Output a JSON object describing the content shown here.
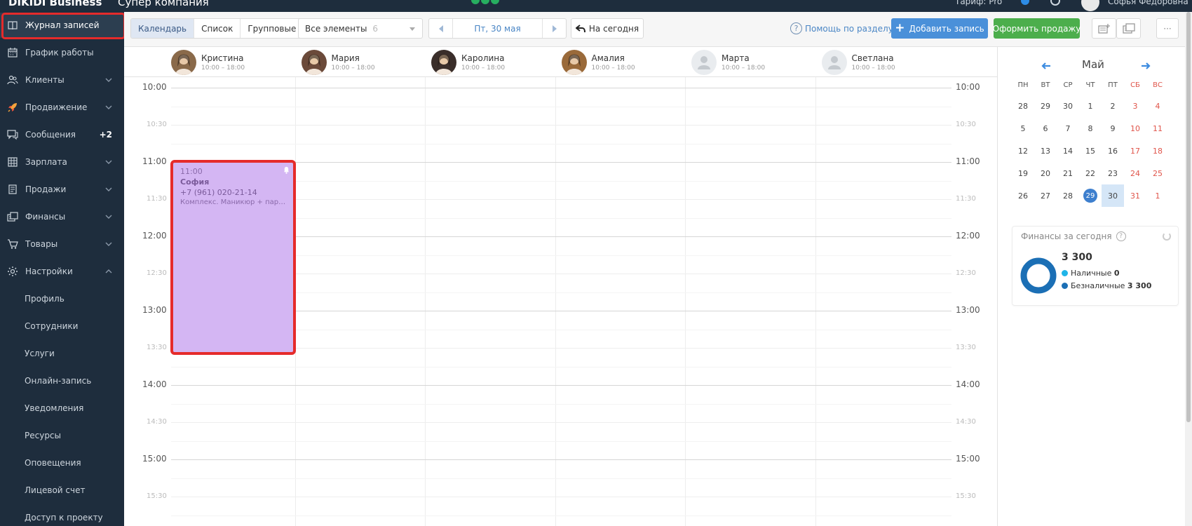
{
  "topbar": {
    "brand": "DIKIDI Business",
    "company": "Супер компания",
    "tariff": "Тариф: Pro",
    "user": "Софья Федоровна"
  },
  "sidebar": {
    "items": [
      {
        "label": "Журнал записей",
        "icon": "journal-icon",
        "active": true
      },
      {
        "label": "График работы",
        "icon": "calendar-grid-icon"
      },
      {
        "label": "Клиенты",
        "icon": "clients-icon",
        "chevron": true
      },
      {
        "label": "Продвижение",
        "icon": "rocket-icon",
        "chevron": true
      },
      {
        "label": "Сообщения",
        "icon": "messages-icon",
        "badge": "+2"
      },
      {
        "label": "Зарплата",
        "icon": "salary-icon",
        "chevron": true
      },
      {
        "label": "Продажи",
        "icon": "sales-icon",
        "chevron": true
      },
      {
        "label": "Финансы",
        "icon": "finance-icon",
        "chevron": true
      },
      {
        "label": "Товары",
        "icon": "cart-icon",
        "chevron": true
      },
      {
        "label": "Настройки",
        "icon": "gear-icon",
        "chevron": true,
        "expanded": true
      }
    ],
    "subitems": [
      "Профиль",
      "Сотрудники",
      "Услуги",
      "Онлайн-запись",
      "Уведомления",
      "Ресурсы",
      "Оповещения",
      "Лицевой счет",
      "Доступ к проекту"
    ]
  },
  "toolbar": {
    "views": [
      "Календарь",
      "Список",
      "Групповые"
    ],
    "filter_label": "Все элементы",
    "filter_count": "6",
    "date": "Пт, 30 мая",
    "today_button": "На сегодня",
    "help": "Помощь по разделу",
    "add_button": "Добавить запись",
    "sale_button": "Оформить продажу",
    "more": "···"
  },
  "staff": [
    {
      "name": "Кристина",
      "hours": "10:00 – 18:00",
      "photo": true,
      "color": "#8a6a4a"
    },
    {
      "name": "Мария",
      "hours": "10:00 – 18:00",
      "photo": true,
      "color": "#6b4a3a"
    },
    {
      "name": "Каролина",
      "hours": "10:00 – 18:00",
      "photo": true,
      "color": "#3a2e2a"
    },
    {
      "name": "Амалия",
      "hours": "10:00 – 18:00",
      "photo": true,
      "color": "#9a6a3a"
    },
    {
      "name": "Марта",
      "hours": "10:00 – 18:00",
      "photo": false
    },
    {
      "name": "Светлана",
      "hours": "10:00 – 18:00",
      "photo": false
    }
  ],
  "times": {
    "hours": [
      "10:00",
      "11:00",
      "12:00",
      "13:00",
      "14:00",
      "15:00"
    ],
    "halves": [
      "10:30",
      "11:30",
      "12:30",
      "13:30",
      "14:30",
      "15:30"
    ]
  },
  "appointment": {
    "time": "11:00",
    "client": "София",
    "phone": "+7 (961) 020-21-14",
    "service": "Комплекс. Маникюр + парафинотерапия"
  },
  "mini_calendar": {
    "month": "Май",
    "dow": [
      "ПН",
      "ВТ",
      "СР",
      "ЧТ",
      "ПТ",
      "СБ",
      "ВС"
    ],
    "weeks": [
      [
        "28",
        "29",
        "30",
        "1",
        "2",
        "3",
        "4"
      ],
      [
        "5",
        "6",
        "7",
        "8",
        "9",
        "10",
        "11"
      ],
      [
        "12",
        "13",
        "14",
        "15",
        "16",
        "17",
        "18"
      ],
      [
        "19",
        "20",
        "21",
        "22",
        "23",
        "24",
        "25"
      ],
      [
        "26",
        "27",
        "28",
        "29",
        "30",
        "31",
        "1"
      ]
    ],
    "today": "29",
    "selected": "30"
  },
  "finance": {
    "title": "Финансы за сегодня",
    "total": "3 300",
    "cash_label": "Наличные",
    "cash_value": "0",
    "noncash_label": "Безналичные",
    "noncash_value": "3 300",
    "cash_color": "#1fb5e8",
    "noncash_color": "#1b6fb5"
  }
}
